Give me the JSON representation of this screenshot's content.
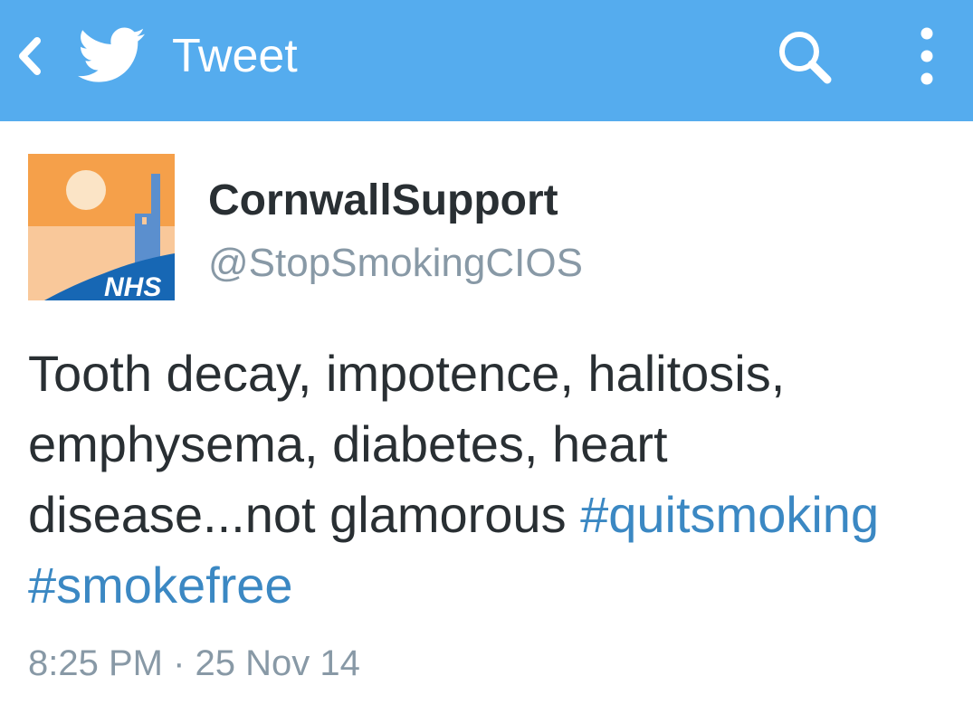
{
  "header": {
    "title": "Tweet",
    "back_icon": "chevron-left-icon",
    "logo_icon": "twitter-bird-icon",
    "search_icon": "search-icon",
    "menu_icon": "overflow-menu-icon",
    "background_color": "#55acee"
  },
  "tweet": {
    "display_name": "CornwallSupport",
    "handle": "@StopSmokingCIOS",
    "avatar": {
      "badge_text": "NHS"
    },
    "text_plain": "Tooth decay, impotence, halitosis, emphysema, diabetes, heart disease...not glamorous",
    "hashtags": [
      "#quitsmoking",
      "#smokefree"
    ],
    "time": "8:25 PM",
    "separator": "·",
    "date": "25 Nov 14",
    "hashtag_color": "#3b88c3"
  }
}
